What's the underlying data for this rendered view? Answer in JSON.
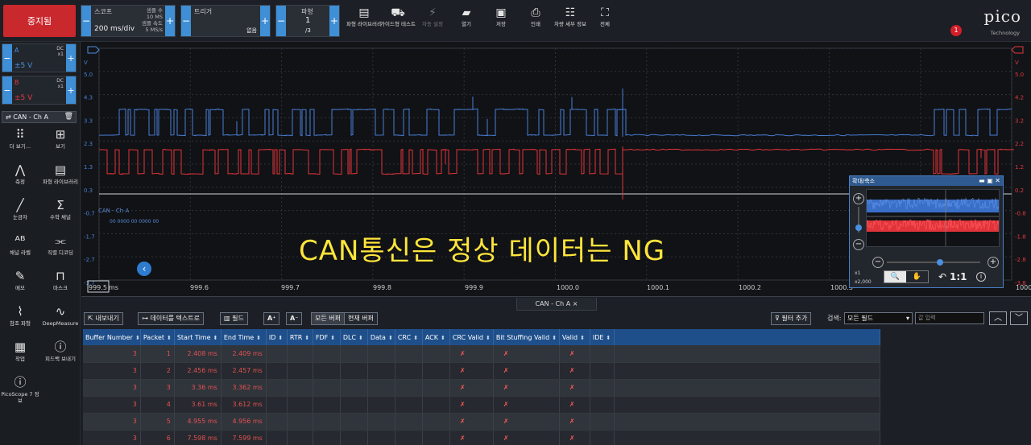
{
  "toolbar": {
    "stop_label": "중지됨",
    "scope": {
      "label": "스코프",
      "value": "200 ms/div",
      "samples_label": "샘플 수",
      "samples_value": "10 MS",
      "rate_label": "샘플 속도",
      "rate_value": "5 MS/s"
    },
    "trigger": {
      "label": "트리거",
      "value": "없음"
    },
    "waveform": {
      "label": "파형",
      "value": "1",
      "total": "/3"
    },
    "buttons": [
      {
        "label": "파형 라이브러리",
        "icon": "library-icon",
        "enabled": true
      },
      {
        "label": "가이드형 테스트",
        "icon": "car-icon",
        "enabled": true
      },
      {
        "label": "자동 설정",
        "icon": "wand-icon",
        "enabled": false
      },
      {
        "label": "열기",
        "icon": "folder-icon",
        "enabled": true
      },
      {
        "label": "저장",
        "icon": "save-icon",
        "enabled": true
      },
      {
        "label": "인쇄",
        "icon": "print-icon",
        "enabled": true
      },
      {
        "label": "차량 세부 정보",
        "icon": "clipboard-icon",
        "enabled": true
      },
      {
        "label": "전체",
        "icon": "fullscreen-icon",
        "enabled": true
      }
    ],
    "logo": {
      "brand": "pico",
      "sub": "Technology",
      "badge": "1"
    }
  },
  "sidebar": {
    "channels": [
      {
        "name": "A",
        "coupling": "DC",
        "probe": "x1",
        "range": "±5 V",
        "color": "#4a90e2"
      },
      {
        "name": "B",
        "coupling": "DC",
        "probe": "x1",
        "range": "±5 V",
        "color": "#e0393e"
      }
    ],
    "decoder_tab": "CAN - Ch A",
    "buttons": [
      {
        "label": "더 보기...",
        "icon": "more-dots-icon"
      },
      {
        "label": "보기",
        "icon": "view-grid-icon"
      },
      {
        "label": "측정",
        "icon": "measure-icon"
      },
      {
        "label": "파형 라이브러리",
        "icon": "library-icon"
      },
      {
        "label": "눈금자",
        "icon": "ruler-icon"
      },
      {
        "label": "수학 채널",
        "icon": "sigma-icon"
      },
      {
        "label": "채널 라벨",
        "icon": "abcd-icon"
      },
      {
        "label": "직렬 디코딩",
        "icon": "serial-decode-icon"
      },
      {
        "label": "메모",
        "icon": "note-icon"
      },
      {
        "label": "마스크",
        "icon": "mask-icon"
      },
      {
        "label": "참조 파형",
        "icon": "reference-icon"
      },
      {
        "label": "DeepMeasure",
        "icon": "deepmeasure-icon"
      },
      {
        "label": "작업",
        "icon": "clapper-icon"
      },
      {
        "label": "피드백 보내기",
        "icon": "feedback-icon"
      },
      {
        "label": "PicoScope 7 정보",
        "icon": "info-icon"
      }
    ]
  },
  "scope": {
    "y_left": [
      "V",
      "5.0",
      "4.3",
      "3.3",
      "2.3",
      "1.3",
      "0.3",
      "-0.7",
      "-1.7",
      "-2.7",
      "-3.7"
    ],
    "y_right": [
      "V",
      "5.0",
      "4.2",
      "3.2",
      "2.2",
      "1.2",
      "0.2",
      "-0.8",
      "-1.8",
      "-2.8",
      "-3.8"
    ],
    "x_ticks": [
      "999.5",
      "999.6",
      "999.7",
      "999.8",
      "999.9",
      "1000.0",
      "1000.1",
      "1000.2",
      "1000.3",
      "1000.5"
    ],
    "x_unit": "ms",
    "decoder_label": "CAN - Ch A",
    "decoder_sub": "00 0000 00 0000 00",
    "overlay_text": "CAN통신은 정상 데이터는 NG",
    "colors": {
      "chA": "#4a7fd6",
      "chB": "#e0343a",
      "grid": "#2f333a"
    }
  },
  "zoom_panel": {
    "title": "확대/축소",
    "x_zoom": "x1",
    "x_zoom2": "x2,000",
    "ratio": "1:1"
  },
  "decode_pane": {
    "tab": "CAN - Ch A",
    "tools": {
      "export": "내보내기",
      "as_text": "데이터를 텍스트로",
      "fields": "필드",
      "all_buffers": "모든 버퍼",
      "current_buffer": "현재 버퍼",
      "add_filter": "필터 추가",
      "search_label": "검색:",
      "search_field": "모든 필드",
      "search_placeholder": "값 입력"
    },
    "columns": [
      "Buffer Number",
      "Packet",
      "Start Time",
      "End Time",
      "ID",
      "RTR",
      "FDF",
      "DLC",
      "Data",
      "CRC",
      "ACK",
      "CRC Valid",
      "Bit Stuffing Valid",
      "Valid",
      "IDE"
    ],
    "rows": [
      [
        "3",
        "1",
        "2.408 ms",
        "2.409 ms",
        "",
        "",
        "",
        "",
        "",
        "",
        "",
        "✗",
        "✗",
        "✗",
        ""
      ],
      [
        "3",
        "2",
        "2.456 ms",
        "2.457 ms",
        "",
        "",
        "",
        "",
        "",
        "",
        "",
        "✗",
        "✗",
        "✗",
        ""
      ],
      [
        "3",
        "3",
        "3.36 ms",
        "3.362 ms",
        "",
        "",
        "",
        "",
        "",
        "",
        "",
        "✗",
        "✗",
        "✗",
        ""
      ],
      [
        "3",
        "4",
        "3.61 ms",
        "3.612 ms",
        "",
        "",
        "",
        "",
        "",
        "",
        "",
        "✗",
        "✗",
        "✗",
        ""
      ],
      [
        "3",
        "5",
        "4.955 ms",
        "4.956 ms",
        "",
        "",
        "",
        "",
        "",
        "",
        "",
        "✗",
        "✗",
        "✗",
        ""
      ],
      [
        "3",
        "6",
        "7.598 ms",
        "7.599 ms",
        "",
        "",
        "",
        "",
        "",
        "",
        "",
        "✗",
        "✗",
        "✗",
        ""
      ]
    ]
  }
}
